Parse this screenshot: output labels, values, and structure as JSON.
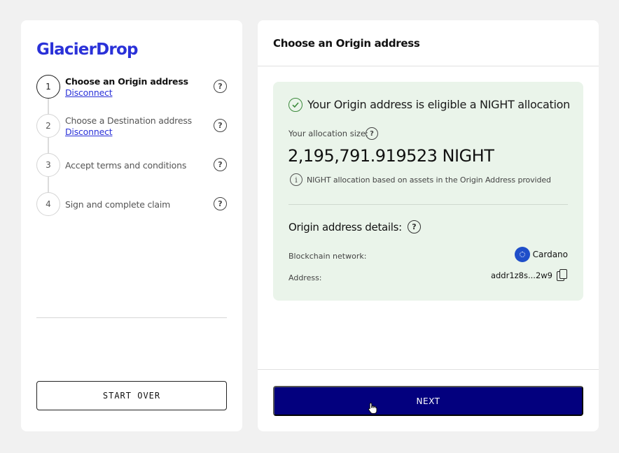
{
  "brand": {
    "logo_text": "GlacierDrop",
    "accent_color": "#2a31d8",
    "button_color": "#03007e"
  },
  "steps": [
    {
      "number": "1",
      "label": "Choose an Origin address",
      "link": "Disconnect",
      "active": true
    },
    {
      "number": "2",
      "label": "Choose a Destination address",
      "link": "Disconnect",
      "active": false
    },
    {
      "number": "3",
      "label": "Accept terms and conditions",
      "active": false
    },
    {
      "number": "4",
      "label": "Sign and complete claim",
      "active": false
    }
  ],
  "help_glyph": "?",
  "start_over_label": "START OVER",
  "main": {
    "title": "Choose an Origin address",
    "eligibility": {
      "message": "Your Origin address is eligible a NIGHT allocation",
      "status_color": "#3c8a3c",
      "allocation_label": "Your allocation size:",
      "allocation_value": "2,195,791.919523 NIGHT",
      "info_glyph": "i",
      "info_text": "NIGHT allocation based on assets in the Origin Address provided"
    },
    "details": {
      "title": "Origin address details:",
      "network_label": "Blockchain network:",
      "network_value": "Cardano",
      "network_icon": "cardano-icon",
      "address_label": "Address:",
      "address_value": "addr1z8s...2w9",
      "copy_icon": "copy-icon"
    },
    "next_label": "NEXT"
  }
}
